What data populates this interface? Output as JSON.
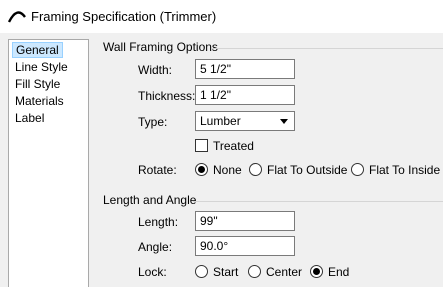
{
  "window": {
    "title": "Framing Specification (Trimmer)",
    "icon": "roof-arch-icon"
  },
  "sidebar": {
    "items": [
      {
        "label": "General",
        "selected": true
      },
      {
        "label": "Line Style",
        "selected": false
      },
      {
        "label": "Fill Style",
        "selected": false
      },
      {
        "label": "Materials",
        "selected": false
      },
      {
        "label": "Label",
        "selected": false
      }
    ]
  },
  "wall_framing": {
    "group_title": "Wall Framing Options",
    "width_label": "Width:",
    "width_value": "5 1/2\"",
    "thickness_label": "Thickness:",
    "thickness_value": "1 1/2\"",
    "type_label": "Type:",
    "type_value": "Lumber",
    "treated_label": "Treated",
    "treated_checked": false,
    "rotate_label": "Rotate:",
    "rotate_options": [
      "None",
      "Flat To Outside",
      "Flat To Inside"
    ],
    "rotate_selected": "None"
  },
  "length_angle": {
    "group_title": "Length and Angle",
    "length_label": "Length:",
    "length_value": "99\"",
    "angle_label": "Angle:",
    "angle_value": "90.0°",
    "lock_label": "Lock:",
    "lock_options": [
      "Start",
      "Center",
      "End"
    ],
    "lock_selected": "End"
  },
  "colors": {
    "selection_fill": "#cce8ff",
    "selection_border": "#99d1ff",
    "dialog_bg": "#f0f0f0"
  }
}
